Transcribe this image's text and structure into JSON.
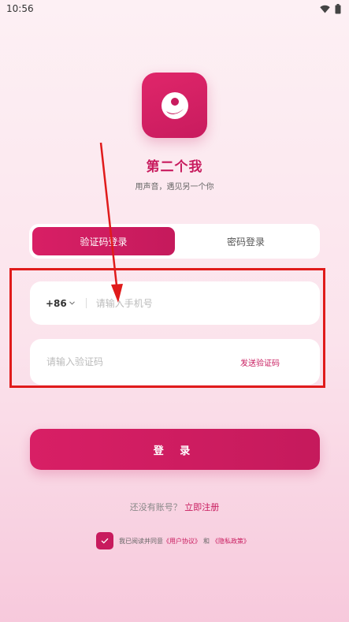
{
  "status_bar": {
    "time": "10:56"
  },
  "app": {
    "title": "第二个我",
    "slogan": "用声音，遇见另一个你"
  },
  "tabs": [
    {
      "label": "验证码登录",
      "active": true
    },
    {
      "label": "密码登录",
      "active": false
    }
  ],
  "phone_field": {
    "country_code": "+86",
    "value": "",
    "placeholder": "请输入手机号"
  },
  "code_field": {
    "value": "",
    "placeholder": "请输入验证码",
    "send_code_label": "发送验证码"
  },
  "login_button": {
    "label": "登 录"
  },
  "register": {
    "prompt": "还没有账号？",
    "link": "立即注册"
  },
  "agreement": {
    "checked": true,
    "prefix": "我已阅读并同意",
    "user_agreement": "《用户协议》",
    "conjunction": "和",
    "privacy_policy": "《隐私政策》"
  },
  "colors": {
    "brand": "#c81b5e",
    "annotation": "#e01b1b"
  },
  "icons": {
    "status": [
      "wifi-icon",
      "battery-icon"
    ],
    "logo": "app-logo-icon",
    "country_dropdown": "chevron-down-icon",
    "checkbox": "check-icon"
  }
}
